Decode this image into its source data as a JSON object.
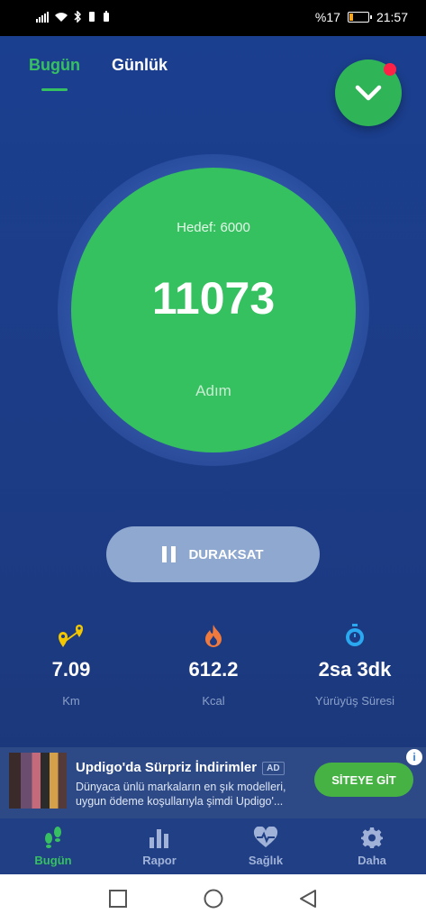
{
  "status": {
    "battery_text": "%17",
    "time": "21:57"
  },
  "tabs": [
    {
      "label": "Bugün",
      "active": true
    },
    {
      "label": "Günlük",
      "active": false
    }
  ],
  "goal_text": "Hedef: 6000",
  "steps": "11073",
  "steps_unit": "Adım",
  "pause_label": "DURAKSAT",
  "stats": [
    {
      "value": "7.09",
      "label": "Km",
      "icon": "route-icon"
    },
    {
      "value": "612.2",
      "label": "Kcal",
      "icon": "flame-icon"
    },
    {
      "value": "2sa 3dk",
      "label": "Yürüyüş Süresi",
      "icon": "stopwatch-icon"
    }
  ],
  "ad": {
    "title": "Updigo'da Sürpriz İndirimler",
    "badge": "AD",
    "description": "Dünyaca ünlü markaların en şık modelleri, uygun ödeme koşullarıyla şimdi Updigo'...",
    "cta": "SİTEYE GİT",
    "info": "i"
  },
  "nav": [
    {
      "label": "Bugün",
      "icon": "footsteps-icon",
      "active": true
    },
    {
      "label": "Rapor",
      "icon": "bar-chart-icon",
      "active": false
    },
    {
      "label": "Sağlık",
      "icon": "heart-pulse-icon",
      "active": false
    },
    {
      "label": "Daha",
      "icon": "gear-icon",
      "active": false
    }
  ],
  "colors": {
    "accent": "#37c061",
    "background": "#1c3b84",
    "notification": "#ff2146"
  }
}
